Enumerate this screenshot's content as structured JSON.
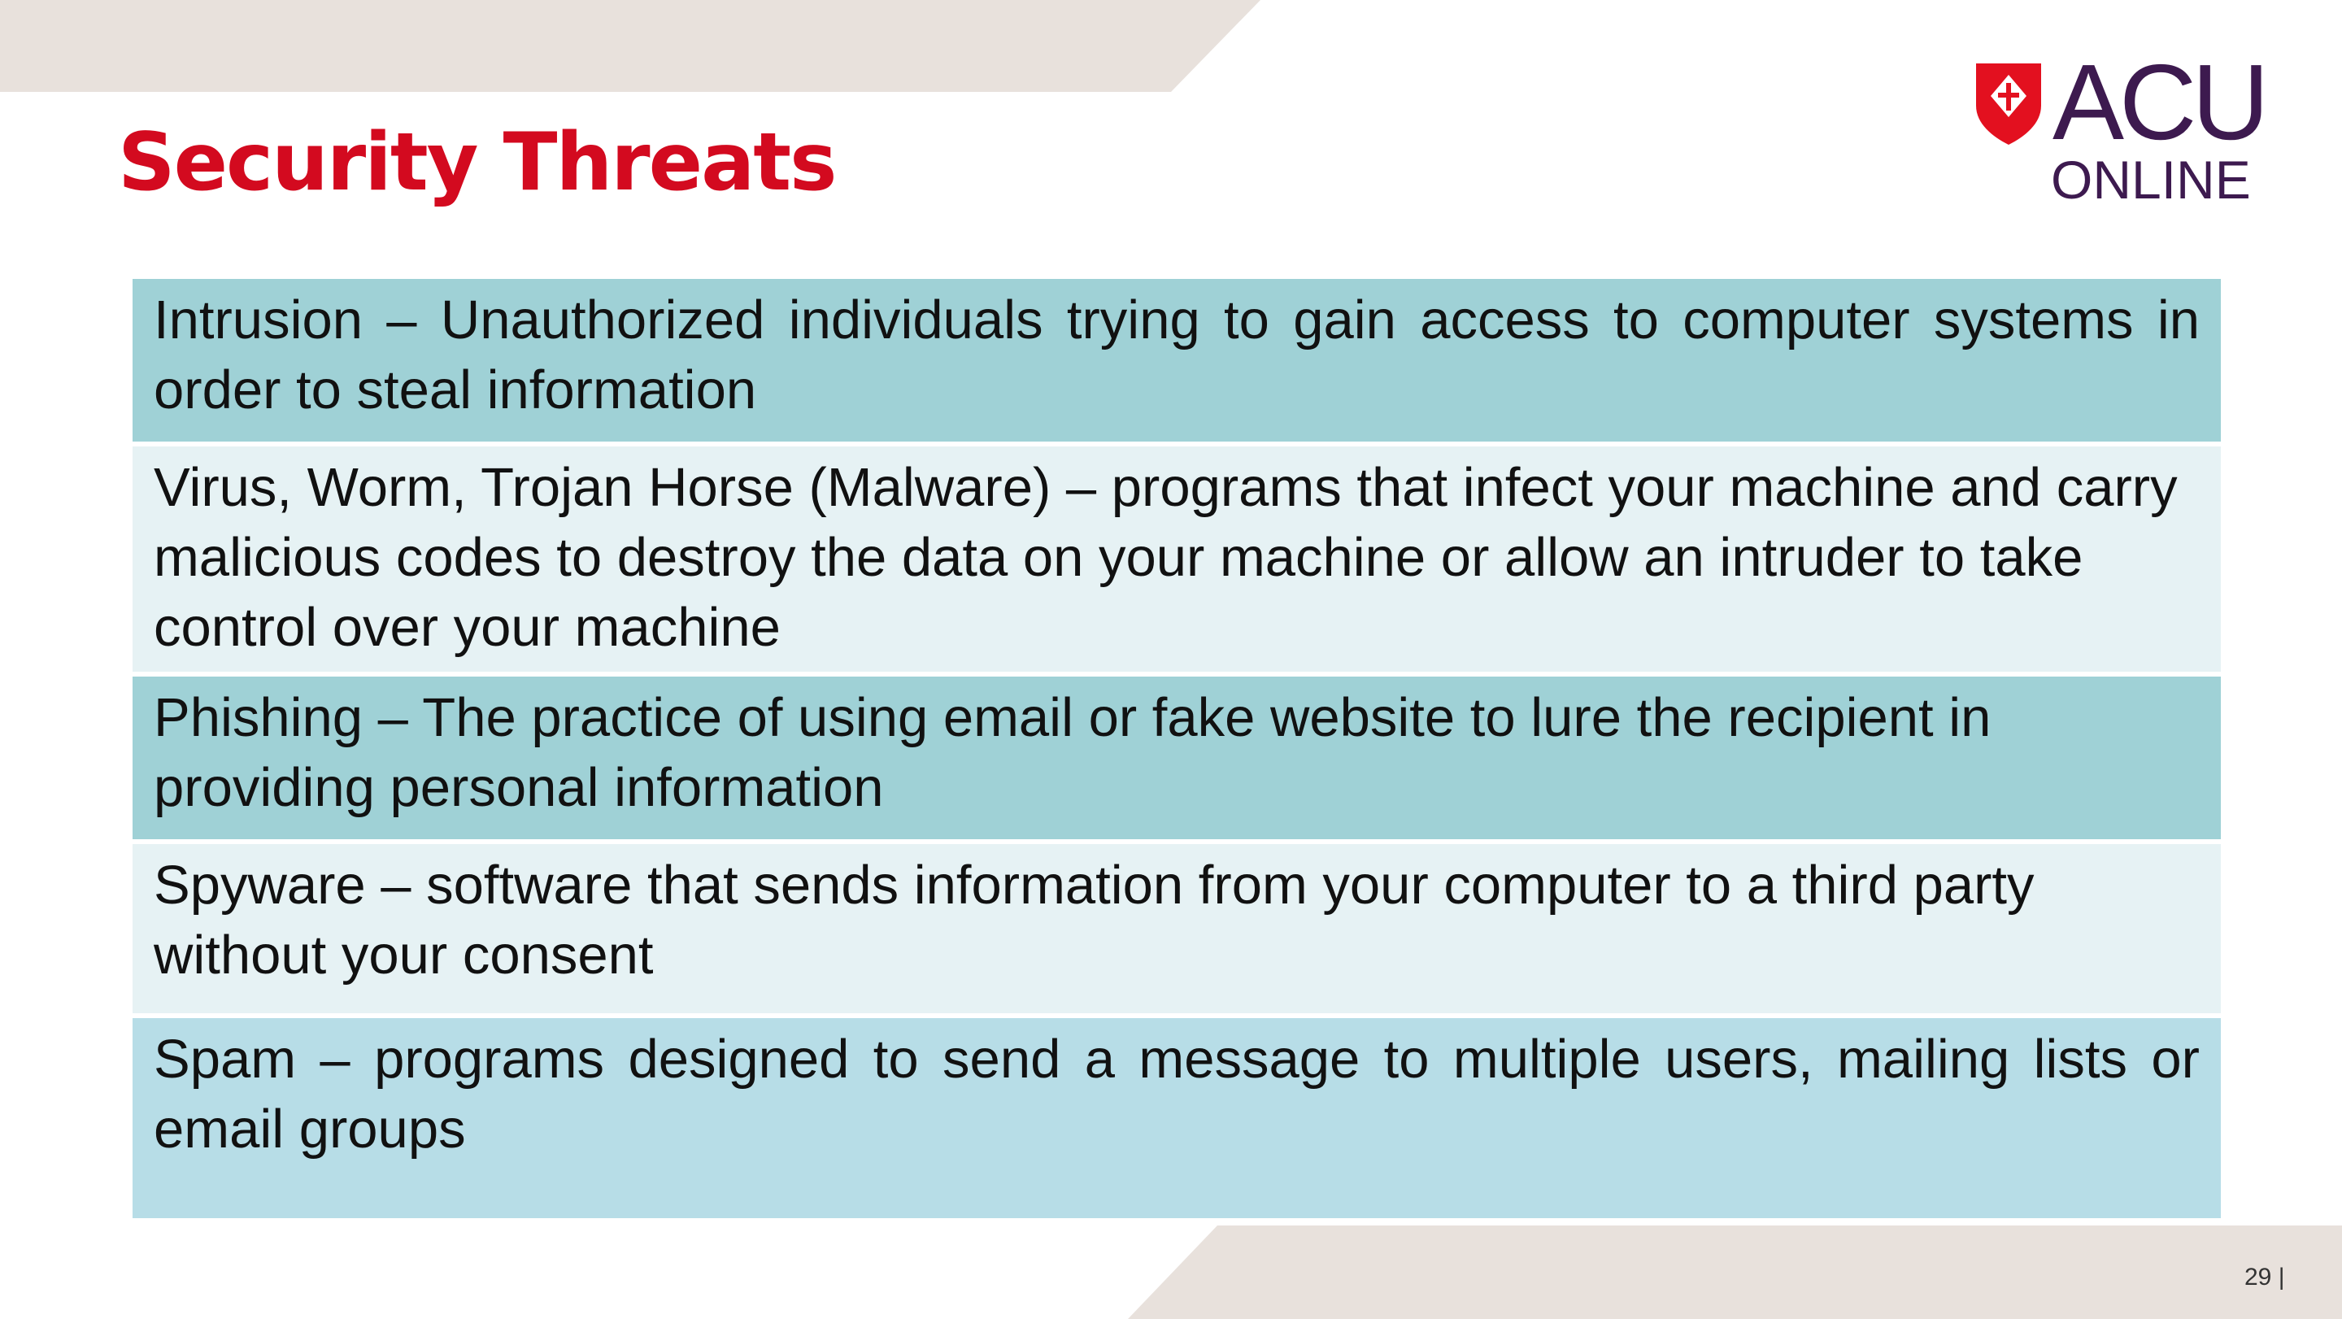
{
  "slide": {
    "title": "Security Threats",
    "page_number": "29 |",
    "colors": {
      "title": "#d30a1f",
      "brand_purple": "#3d1a4f",
      "shield_red": "#e3101f",
      "band": "#e8e1dc",
      "row_dark": "#9fd1d6",
      "row_light": "#e6f2f4",
      "row_last": "#b7dde7"
    }
  },
  "logo": {
    "name": "ACU",
    "subtitle": "ONLINE",
    "icon": "shield-cross-icon"
  },
  "threats": [
    {
      "text": "Intrusion – Unauthorized individuals trying to gain access to computer systems in order to steal information"
    },
    {
      "text": "Virus, Worm, Trojan Horse (Malware) – programs that infect your machine and carry malicious codes to destroy the data on your machine or allow an intruder to take control over your machine"
    },
    {
      "text": "Phishing – The practice of using email or fake website to lure the recipient in providing personal information"
    },
    {
      "text": "Spyware – software that sends information from your computer to a third party without your consent"
    },
    {
      "text": "Spam – programs designed to send a message to multiple users, mailing lists  or email groups"
    }
  ]
}
